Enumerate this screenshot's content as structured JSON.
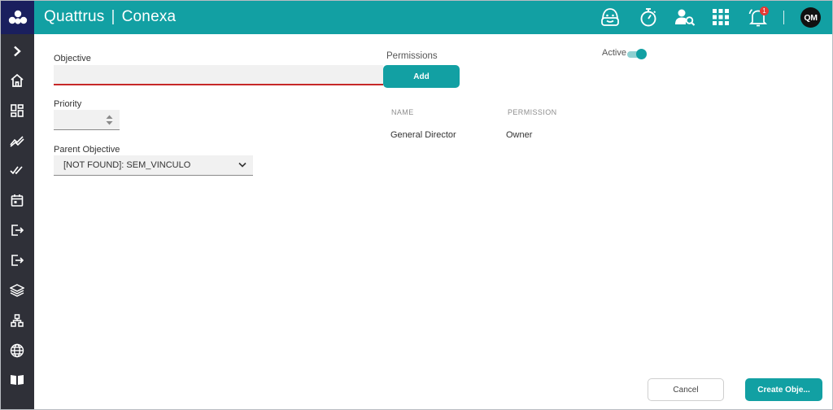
{
  "header": {
    "brand": "Quattrus",
    "separator": "|",
    "product": "Conexa",
    "icons": [
      "assistant-icon",
      "stopwatch-icon",
      "user-search-icon",
      "apps-grid-icon",
      "bell-icon"
    ],
    "notification_count": "1",
    "avatar_initials": "QM",
    "accent_color": "#12a0a3",
    "logo_bg_color": "#1a1f5e"
  },
  "sidebar": {
    "bg_color": "#2f3038",
    "items": [
      "expand-chevron-icon",
      "home-icon",
      "dashboard-icon",
      "trend-icon",
      "double-check-icon",
      "calendar-icon",
      "login-icon",
      "logout-icon",
      "layers-icon",
      "hierarchy-icon",
      "globe-icon",
      "book-icon"
    ]
  },
  "form": {
    "objective_label": "Objective",
    "objective_value": "",
    "priority_label": "Priority",
    "priority_value": "",
    "parent_label": "Parent Objective",
    "parent_value": "[NOT FOUND]: SEM_VINCULO",
    "error_color": "#c62828"
  },
  "permissions": {
    "title": "Permissions",
    "add_label": "Add",
    "columns": [
      "NAME",
      "PERMISSION"
    ],
    "rows": [
      {
        "name": "General Director",
        "permission": "Owner"
      }
    ]
  },
  "active": {
    "label": "Active",
    "value": true
  },
  "footer": {
    "cancel_label": "Cancel",
    "create_label": "Create Obje..."
  }
}
